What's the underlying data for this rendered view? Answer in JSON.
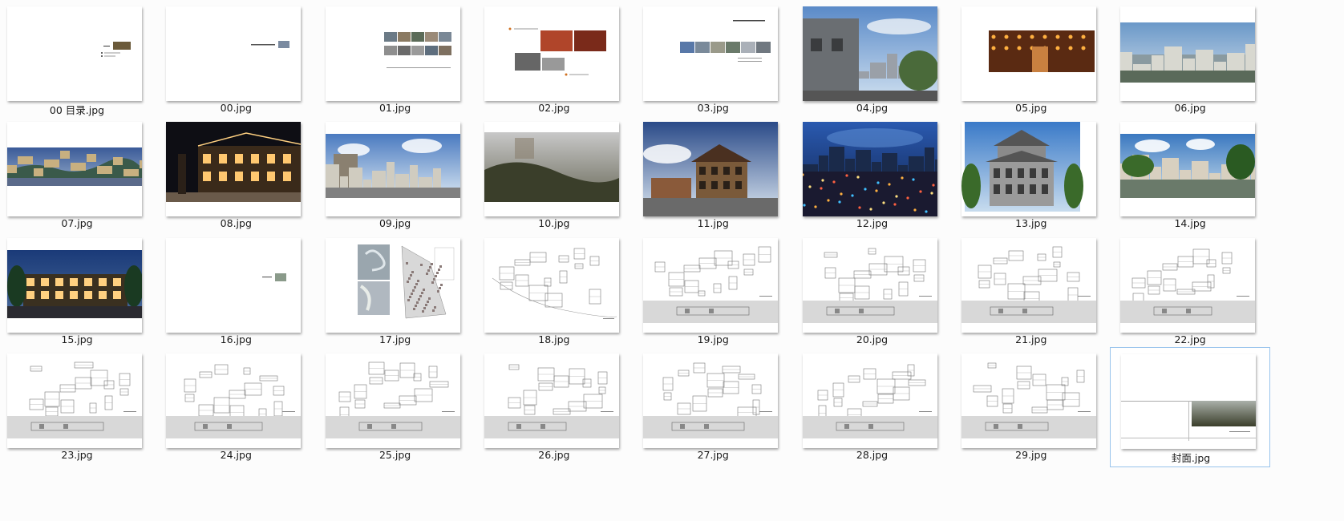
{
  "files": [
    {
      "name": "00 目录.jpg",
      "kind": "toc"
    },
    {
      "name": "00.jpg",
      "kind": "title"
    },
    {
      "name": "01.jpg",
      "kind": "collage"
    },
    {
      "name": "02.jpg",
      "kind": "collage2"
    },
    {
      "name": "03.jpg",
      "kind": "strip"
    },
    {
      "name": "04.jpg",
      "kind": "photo-day"
    },
    {
      "name": "05.jpg",
      "kind": "photo-interior"
    },
    {
      "name": "06.jpg",
      "kind": "photo-aerial"
    },
    {
      "name": "07.jpg",
      "kind": "photo-panorama"
    },
    {
      "name": "08.jpg",
      "kind": "photo-night"
    },
    {
      "name": "09.jpg",
      "kind": "photo-street"
    },
    {
      "name": "10.jpg",
      "kind": "photo-fog"
    },
    {
      "name": "11.jpg",
      "kind": "photo-building"
    },
    {
      "name": "12.jpg",
      "kind": "photo-city-night"
    },
    {
      "name": "13.jpg",
      "kind": "photo-tower"
    },
    {
      "name": "14.jpg",
      "kind": "photo-garden"
    },
    {
      "name": "15.jpg",
      "kind": "photo-dusk"
    },
    {
      "name": "16.jpg",
      "kind": "small-logo"
    },
    {
      "name": "17.jpg",
      "kind": "map"
    },
    {
      "name": "18.jpg",
      "kind": "plan"
    },
    {
      "name": "19.jpg",
      "kind": "plan-elev"
    },
    {
      "name": "20.jpg",
      "kind": "plan-elev"
    },
    {
      "name": "21.jpg",
      "kind": "plan-elev"
    },
    {
      "name": "22.jpg",
      "kind": "plan-elev"
    },
    {
      "name": "23.jpg",
      "kind": "plan-elev"
    },
    {
      "name": "24.jpg",
      "kind": "plan-elev"
    },
    {
      "name": "25.jpg",
      "kind": "plan-elev"
    },
    {
      "name": "26.jpg",
      "kind": "plan-elev"
    },
    {
      "name": "27.jpg",
      "kind": "plan-elev"
    },
    {
      "name": "28.jpg",
      "kind": "plan-elev"
    },
    {
      "name": "29.jpg",
      "kind": "plan-elev"
    },
    {
      "name": "封面.jpg",
      "kind": "cover"
    }
  ],
  "selected_index": 31,
  "colors": {
    "selection_border": "#99c4ec",
    "background": "#fcfcfc",
    "label_text": "#1a1a1a"
  }
}
